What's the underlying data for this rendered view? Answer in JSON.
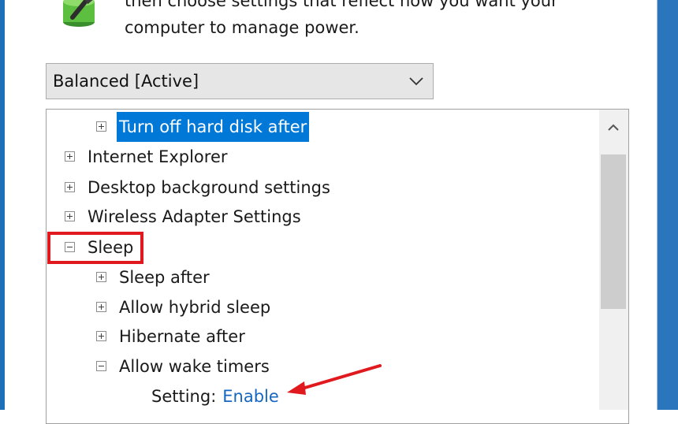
{
  "description": {
    "line1": "then choose settings that reflect how you want your",
    "line2": "computer to manage power."
  },
  "icons": {
    "plan_icon": "power-plug-battery-icon",
    "dropdown_chevron": "chevron-down-icon",
    "scroll_up": "chevron-up-icon",
    "expand": "plus-box-icon",
    "collapse": "minus-box-icon",
    "annotation": "red-arrow-icon"
  },
  "plan_dropdown": {
    "selected": "Balanced [Active]"
  },
  "tree": {
    "items": [
      {
        "label": "Turn off hard disk after",
        "level": 1,
        "expander": "plus",
        "selected": true
      },
      {
        "label": "Internet Explorer",
        "level": 0,
        "expander": "plus",
        "selected": false
      },
      {
        "label": "Desktop background settings",
        "level": 0,
        "expander": "plus",
        "selected": false
      },
      {
        "label": "Wireless Adapter Settings",
        "level": 0,
        "expander": "plus",
        "selected": false
      },
      {
        "label": "Sleep",
        "level": 0,
        "expander": "minus",
        "selected": false
      },
      {
        "label": "Sleep after",
        "level": 1,
        "expander": "plus",
        "selected": false
      },
      {
        "label": "Allow hybrid sleep",
        "level": 1,
        "expander": "plus",
        "selected": false
      },
      {
        "label": "Hibernate after",
        "level": 1,
        "expander": "plus",
        "selected": false
      },
      {
        "label": "Allow wake timers",
        "level": 1,
        "expander": "minus",
        "selected": false
      }
    ],
    "setting": {
      "label": "Setting:",
      "value": "Enable"
    }
  },
  "colors": {
    "selection": "#0078d7",
    "annotation_red": "#e0191e",
    "link_blue": "#1566c0",
    "window_border": "#2b75bd"
  }
}
